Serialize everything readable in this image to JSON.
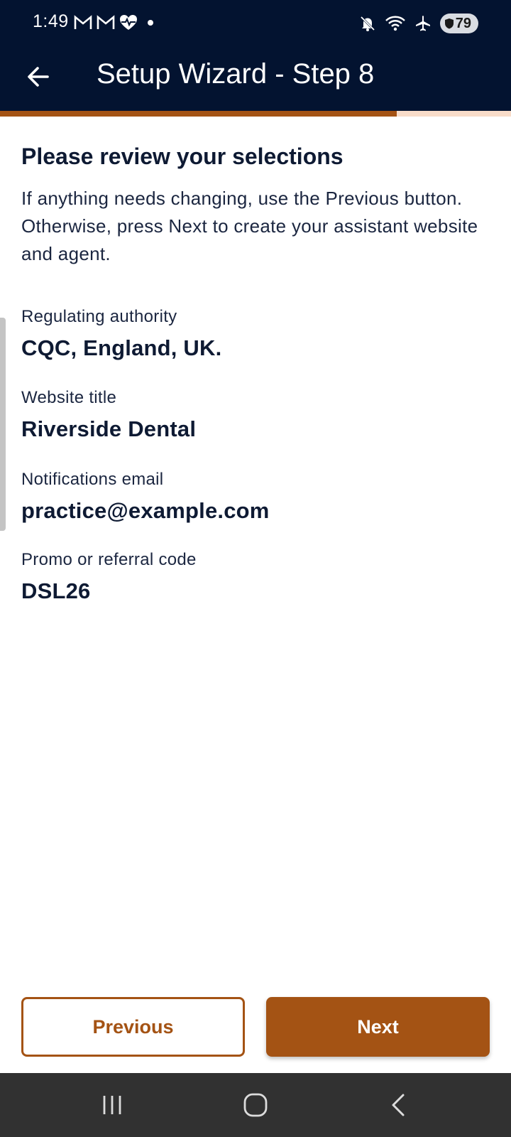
{
  "status_bar": {
    "time": "1:49",
    "battery": "79",
    "left_icons": [
      "gmail-icon",
      "gmail-icon",
      "health-heart-icon",
      "dot-icon"
    ],
    "right_icons": [
      "mute-icon",
      "wifi-icon",
      "airplane-icon"
    ]
  },
  "app_bar": {
    "title": "Setup Wizard - Step 8",
    "back_icon": "arrow-left-icon",
    "progress": 0.777
  },
  "review": {
    "heading": "Please review your selections",
    "intro": "If anything needs changing, use the Previous button. Otherwise, press Next to create your assistant website and agent."
  },
  "fields": [
    {
      "label": "Regulating authority",
      "value": "CQC, England, UK."
    },
    {
      "label": "Website title",
      "value": "Riverside Dental"
    },
    {
      "label": "Notifications email",
      "value": "practice@example.com"
    },
    {
      "label": "Promo or referral code",
      "value": "DSL26"
    }
  ],
  "actions": {
    "previous_label": "Previous",
    "next_label": "Next"
  },
  "nav_bar": {
    "icons": [
      "recent-apps-icon",
      "home-icon",
      "back-icon"
    ]
  },
  "colors": {
    "header_bg": "#031330",
    "accent": "#a45314",
    "progress_track": "#f8dcc9"
  }
}
